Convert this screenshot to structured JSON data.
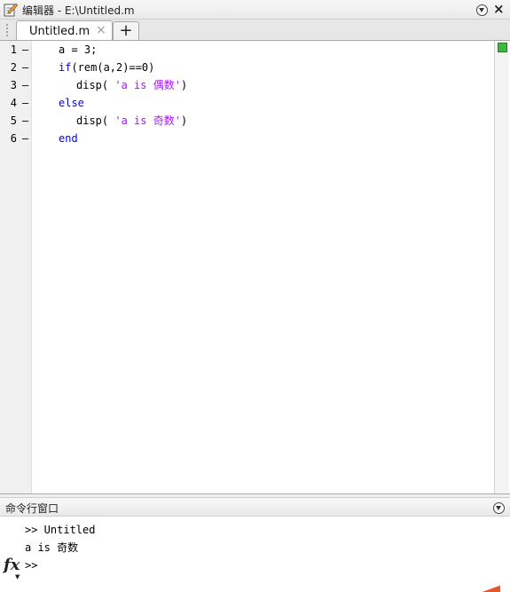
{
  "editor": {
    "title": "编辑器 - E:\\Untitled.m",
    "tabs": [
      {
        "label": "Untitled.m",
        "active": true
      }
    ],
    "new_tab_label": "+",
    "close_glyph": "×",
    "tab_close_glyph": "×"
  },
  "code": {
    "lines": [
      {
        "number": "1",
        "marker": "–"
      },
      {
        "number": "2",
        "marker": "–"
      },
      {
        "number": "3",
        "marker": "–"
      },
      {
        "number": "4",
        "marker": "–"
      },
      {
        "number": "5",
        "marker": "–"
      },
      {
        "number": "6",
        "marker": "–"
      }
    ],
    "l1": "a = 3;",
    "l2_kw": "if",
    "l2_rest": "(rem(a,2)==0)",
    "l3_fn": "disp( ",
    "l3_str": "'a is 偶数'",
    "l3_end": ")",
    "l4_kw": "else",
    "l5_fn": "disp( ",
    "l5_str": "'a is 奇数'",
    "l5_end": ")",
    "l6_kw": "end"
  },
  "command_window": {
    "title": "命令行窗口",
    "fx_label": "fx",
    "fx_caret": "▼",
    "history": [
      ">> Untitled",
      "a is 奇数"
    ],
    "prompt": ">>"
  },
  "colors": {
    "keyword": "#0000ff",
    "string": "#a020f0",
    "status_ok": "#3cb83c"
  },
  "icons": {
    "editor": "pencil-editor-icon",
    "menu": "circle-chevron-down-icon",
    "close": "close-icon"
  }
}
